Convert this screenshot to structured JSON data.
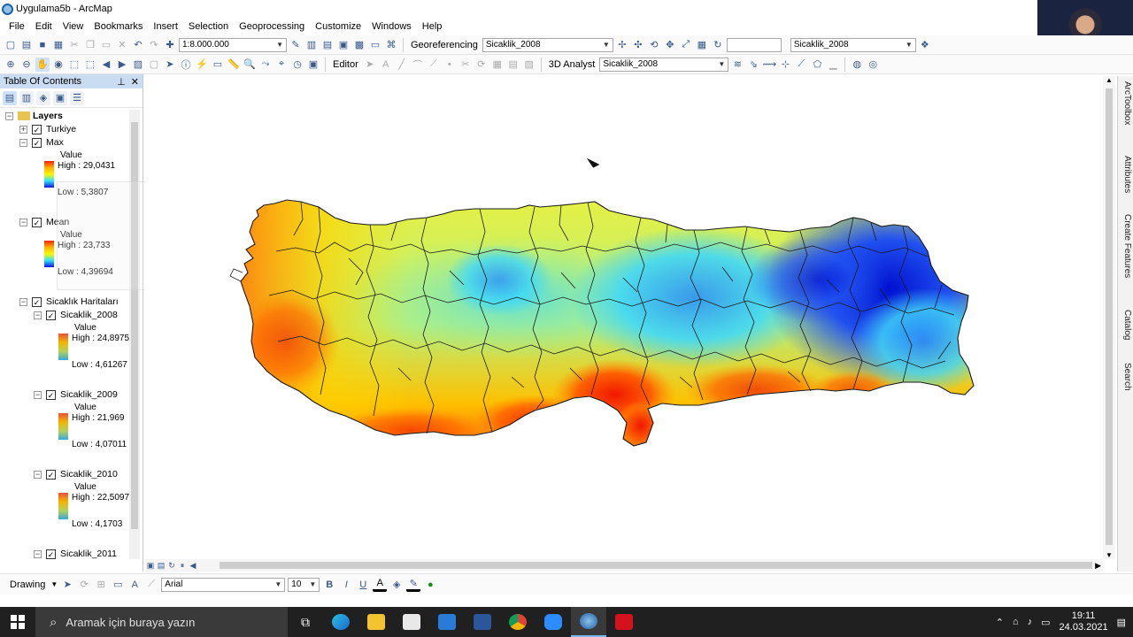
{
  "window": {
    "title": "Uygulama5b - ArcMap"
  },
  "menu": [
    "File",
    "Edit",
    "View",
    "Bookmarks",
    "Insert",
    "Selection",
    "Geoprocessing",
    "Customize",
    "Windows",
    "Help"
  ],
  "toolbar1": {
    "scale": "1:8.000.000",
    "georeferencing_label": "Georeferencing",
    "georef_layer": "Sicaklik_2008",
    "search_value": "",
    "layer_combo": "Sicaklik_2008"
  },
  "toolbar2": {
    "editor_label": "Editor",
    "analyst_label": "3D Analyst",
    "analyst_layer": "Sicaklik_2008"
  },
  "toc": {
    "title": "Table Of Contents",
    "root": "Layers",
    "layers": [
      {
        "name": "Turkiye"
      },
      {
        "name": "Max",
        "field": "Value",
        "high": "High : 29,0431",
        "low": "Low : 5,3807"
      },
      {
        "name": "Mean",
        "field": "Value",
        "high": "High : 23,733",
        "low": "Low : 4,39694"
      }
    ],
    "group": {
      "name": "Sicaklık Haritaları",
      "layers": [
        {
          "name": "Sicaklik_2008",
          "field": "Value",
          "high": "High : 24,8975",
          "low": "Low : 4,61267"
        },
        {
          "name": "Sicaklik_2009",
          "field": "Value",
          "high": "High : 21,969",
          "low": "Low : 4,07011"
        },
        {
          "name": "Sicaklik_2010",
          "field": "Value",
          "high": "High : 22,5097",
          "low": "Low : 4,1703"
        },
        {
          "name": "Sicaklik_2011"
        }
      ]
    }
  },
  "dock_tabs": [
    "ArcToolbox",
    "Attributes",
    "Create Features",
    "Catalog",
    "Search"
  ],
  "drawing": {
    "label": "Drawing",
    "font": "Arial",
    "size": "10"
  },
  "taskbar": {
    "search_placeholder": "Aramak için buraya yazın",
    "time": "19:11",
    "date": "24.03.2021"
  },
  "colors": {
    "toc_header": "#c9dcf1",
    "taskbar": "#202020",
    "warm": "#ff3010",
    "cold": "#1020e0"
  }
}
